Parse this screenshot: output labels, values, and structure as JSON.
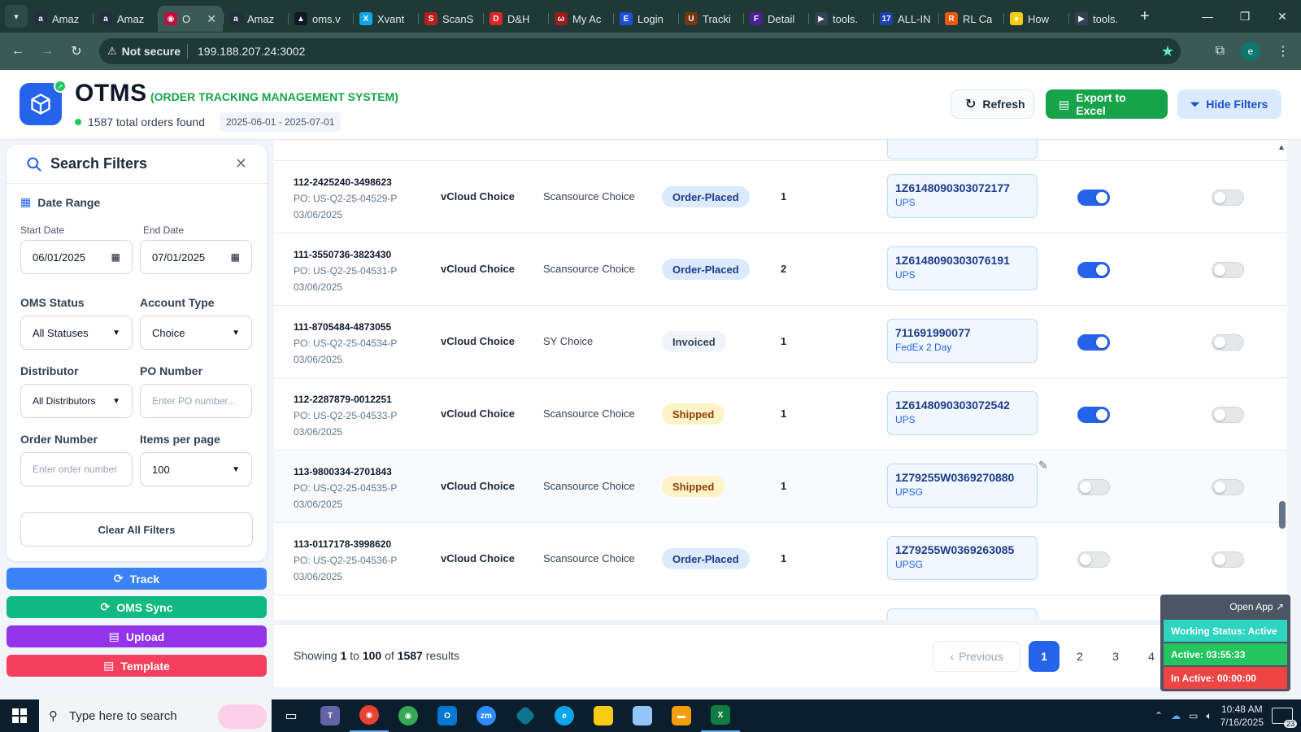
{
  "browser": {
    "tabs": [
      {
        "name": "Amaz",
        "icon": "amazon-icon",
        "color": "#232f3e",
        "glyph": "a"
      },
      {
        "name": "Amaz",
        "icon": "amazon-icon",
        "color": "#232f3e",
        "glyph": "a"
      },
      {
        "name": "O",
        "icon": "otms-icon",
        "color": "#be123c",
        "glyph": "◉",
        "active": true
      },
      {
        "name": "Amaz",
        "icon": "amazon-icon",
        "color": "#232f3e",
        "glyph": "a"
      },
      {
        "name": "oms.v",
        "icon": "triangle-icon",
        "color": "#111827",
        "glyph": "▲"
      },
      {
        "name": "Xvant",
        "icon": "xvant-icon",
        "color": "#0ea5e9",
        "glyph": "X"
      },
      {
        "name": "ScanS",
        "icon": "scansource-icon",
        "color": "#b91c1c",
        "glyph": "S"
      },
      {
        "name": "D&H",
        "icon": "dh-icon",
        "color": "#dc2626",
        "glyph": "D"
      },
      {
        "name": "My Ac",
        "icon": "myaccount-icon",
        "color": "#991b1b",
        "glyph": "ω"
      },
      {
        "name": "Login",
        "icon": "ec-icon",
        "color": "#1d4ed8",
        "glyph": "E"
      },
      {
        "name": "Tracki",
        "icon": "ups-icon",
        "color": "#78350f",
        "glyph": "U"
      },
      {
        "name": "Detail",
        "icon": "fedex-icon",
        "color": "#4c1d95",
        "glyph": "F"
      },
      {
        "name": "tools.",
        "icon": "tools-icon",
        "color": "#334155",
        "glyph": "▶"
      },
      {
        "name": "ALL-IN",
        "icon": "allin-icon",
        "color": "#1e40af",
        "glyph": "17"
      },
      {
        "name": "RL Ca",
        "icon": "rl-icon",
        "color": "#ea580c",
        "glyph": "R"
      },
      {
        "name": "How",
        "icon": "how-icon",
        "color": "#facc15",
        "glyph": "●"
      },
      {
        "name": "tools.",
        "icon": "tools-icon",
        "color": "#334155",
        "glyph": "▶"
      }
    ],
    "not_secure": "Not secure",
    "url": "199.188.207.24:3002",
    "profile_initial": "e"
  },
  "header": {
    "title": "OTMS",
    "subtitle": "(ORDER TRACKING MANAGEMENT SYSTEM)",
    "orders_found": "1587 total orders found",
    "date_range": "2025-06-01 - 2025-07-01",
    "refresh_label": "Refresh",
    "export_label": "Export to Excel",
    "hide_filters_label": "Hide Filters"
  },
  "filters": {
    "title": "Search Filters",
    "date_range_label": "Date Range",
    "start_date_label": "Start Date",
    "start_date_value": "06/01/2025",
    "end_date_label": "End Date",
    "end_date_value": "07/01/2025",
    "oms_status_label": "OMS Status",
    "oms_status_value": "All Statuses",
    "account_type_label": "Account Type",
    "account_type_value": "Choice",
    "distributor_label": "Distributor",
    "distributor_value": "All Distributors",
    "po_number_label": "PO Number",
    "po_number_placeholder": "Enter PO number...",
    "order_number_label": "Order Number",
    "order_number_placeholder": "Enter order number",
    "items_per_page_label": "Items per page",
    "items_per_page_value": "100",
    "clear_label": "Clear All Filters"
  },
  "side_buttons": {
    "track": "Track",
    "oms_sync": "OMS Sync",
    "upload": "Upload",
    "template": "Template"
  },
  "rows": [
    {
      "order": "112-2425240-3498623",
      "po": "PO: US-Q2-25-04529-P",
      "date": "03/06/2025",
      "account": "vCloud Choice",
      "distributor": "Scansource Choice",
      "status": "Order-Placed",
      "status_type": "placed",
      "qty": "1",
      "tracking": "1Z6148090303072177",
      "carrier": "UPS",
      "toggle1": true,
      "toggle2": false
    },
    {
      "order": "111-3550736-3823430",
      "po": "PO: US-Q2-25-04531-P",
      "date": "03/06/2025",
      "account": "vCloud Choice",
      "distributor": "Scansource Choice",
      "status": "Order-Placed",
      "status_type": "placed",
      "qty": "2",
      "tracking": "1Z6148090303076191",
      "carrier": "UPS",
      "toggle1": true,
      "toggle2": false
    },
    {
      "order": "111-8705484-4873055",
      "po": "PO: US-Q2-25-04534-P",
      "date": "03/06/2025",
      "account": "vCloud Choice",
      "distributor": "SY Choice",
      "status": "Invoiced",
      "status_type": "invoiced",
      "qty": "1",
      "tracking": "711691990077",
      "carrier": "FedEx 2 Day",
      "toggle1": true,
      "toggle2": false
    },
    {
      "order": "112-2287879-0012251",
      "po": "PO: US-Q2-25-04533-P",
      "date": "03/06/2025",
      "account": "vCloud Choice",
      "distributor": "Scansource Choice",
      "status": "Shipped",
      "status_type": "shipped",
      "qty": "1",
      "tracking": "1Z6148090303072542",
      "carrier": "UPS",
      "toggle1": true,
      "toggle2": false
    },
    {
      "order": "113-9800334-2701843",
      "po": "PO: US-Q2-25-04535-P",
      "date": "03/06/2025",
      "account": "vCloud Choice",
      "distributor": "Scansource Choice",
      "status": "Shipped",
      "status_type": "shipped",
      "qty": "1",
      "tracking": "1Z79255W0369270880",
      "carrier": "UPSG",
      "toggle1": false,
      "toggle2": false,
      "hover": true
    },
    {
      "order": "113-0117178-3998620",
      "po": "PO: US-Q2-25-04536-P",
      "date": "03/06/2025",
      "account": "vCloud Choice",
      "distributor": "Scansource Choice",
      "status": "Order-Placed",
      "status_type": "placed",
      "qty": "1",
      "tracking": "1Z79255W0369263085",
      "carrier": "UPSG",
      "toggle1": false,
      "toggle2": false
    }
  ],
  "pagination": {
    "showing_prefix": "Showing",
    "from": "1",
    "to_word": "to",
    "to": "100",
    "of_word": "of",
    "total": "1587",
    "results_word": "results",
    "previous_label": "Previous",
    "pages": [
      "1",
      "2",
      "3",
      "4"
    ]
  },
  "widget": {
    "open_app": "Open App ↗",
    "working_status": "Working Status: Active",
    "active_time": "Active: 03:55:33",
    "inactive_time": "In Active: 00:00:00"
  },
  "taskbar": {
    "search_placeholder": "Type here to search",
    "time": "10:48 AM",
    "date": "7/16/2025",
    "notifications": "23"
  }
}
